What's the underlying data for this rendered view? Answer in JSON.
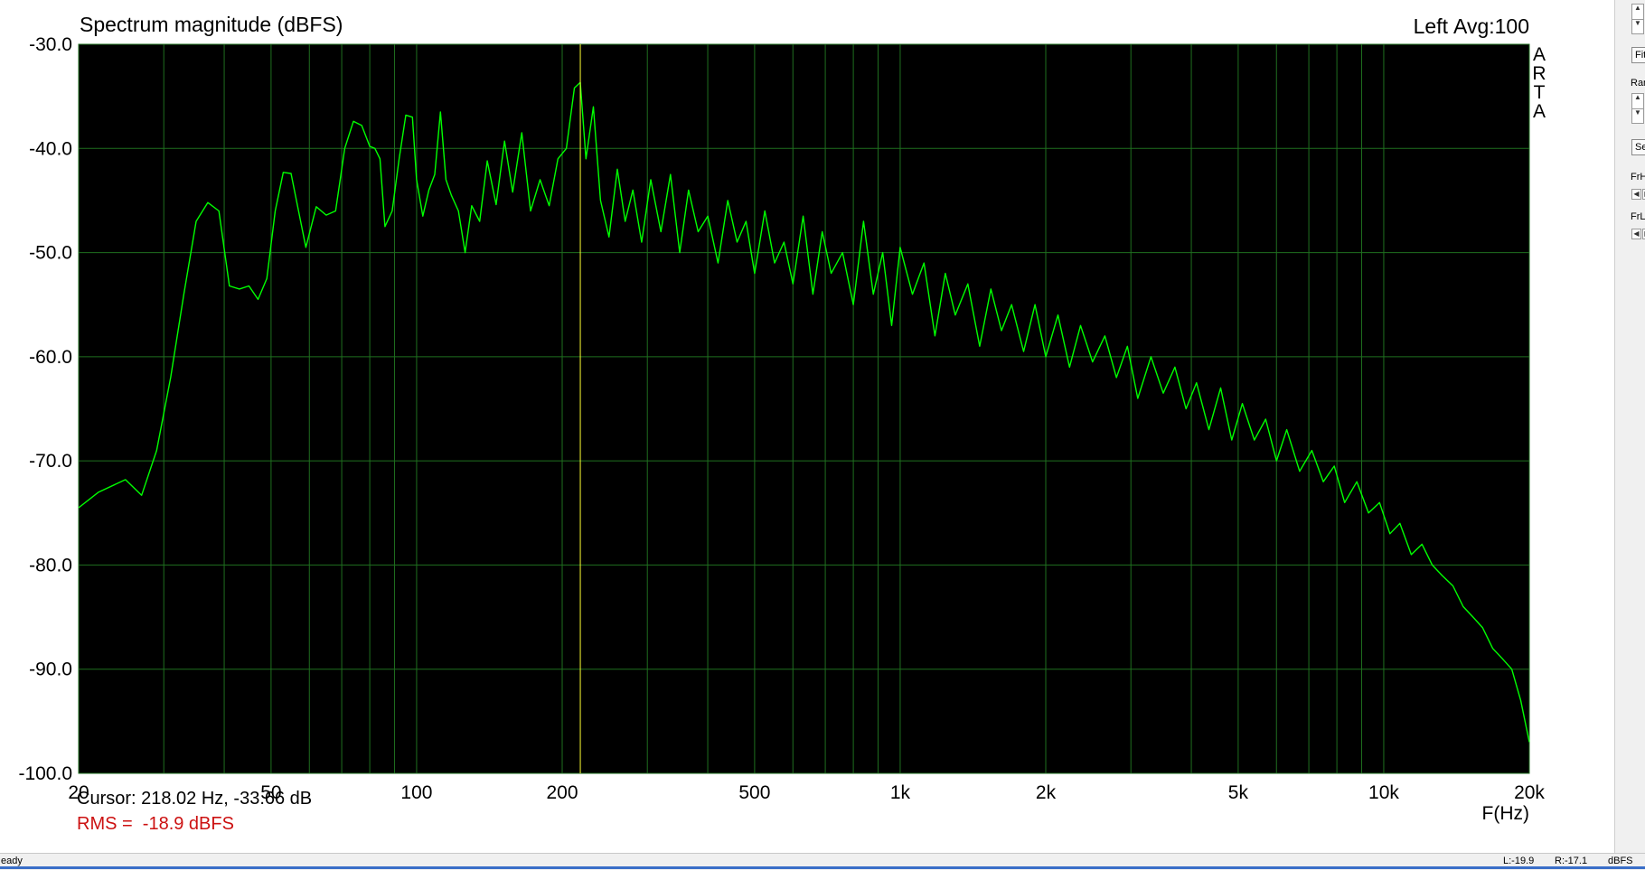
{
  "window": {
    "side_letters": [
      "A",
      "R",
      "T",
      "A"
    ]
  },
  "chart_data": {
    "type": "line",
    "title": "Spectrum magnitude (dBFS)",
    "channel_label": "Left",
    "avg_label": "Avg:100",
    "xlabel": "F(Hz)",
    "ylabel": "",
    "x_scale": "log",
    "xlim": [
      20,
      20000
    ],
    "ylim": [
      -100,
      -30
    ],
    "grid": true,
    "colors": {
      "background": "#000000",
      "grid": "#1f6f1f",
      "series": "#00ff00",
      "cursor": "#ffff33"
    },
    "x_ticks": [
      {
        "value": 20,
        "label": "20"
      },
      {
        "value": 50,
        "label": "50"
      },
      {
        "value": 100,
        "label": "100"
      },
      {
        "value": 200,
        "label": "200"
      },
      {
        "value": 500,
        "label": "500"
      },
      {
        "value": 1000,
        "label": "1k"
      },
      {
        "value": 2000,
        "label": "2k"
      },
      {
        "value": 5000,
        "label": "5k"
      },
      {
        "value": 10000,
        "label": "10k"
      },
      {
        "value": 20000,
        "label": "20k"
      }
    ],
    "y_ticks": [
      {
        "value": -30,
        "label": "-30.0"
      },
      {
        "value": -40,
        "label": "-40.0"
      },
      {
        "value": -50,
        "label": "-50.0"
      },
      {
        "value": -60,
        "label": "-60.0"
      },
      {
        "value": -70,
        "label": "-70.0"
      },
      {
        "value": -80,
        "label": "-80.0"
      },
      {
        "value": -90,
        "label": "-90.0"
      },
      {
        "value": -100,
        "label": "-100.0"
      }
    ],
    "cursor": {
      "x": 218.02,
      "y": -33.66
    },
    "series": [
      {
        "x": [
          20,
          22,
          25,
          27,
          29,
          31,
          33,
          35,
          37,
          39,
          41,
          43,
          45,
          47,
          49,
          51,
          53,
          55,
          57,
          59,
          62,
          65,
          68,
          71,
          74,
          77,
          80,
          82,
          84,
          86,
          89,
          92,
          95,
          98,
          100,
          103,
          106,
          109,
          112,
          115,
          118,
          122,
          126,
          130,
          135,
          140,
          146,
          152,
          158,
          165,
          172,
          180,
          188,
          196,
          204,
          212,
          218,
          224,
          232,
          240,
          250,
          260,
          270,
          280,
          292,
          305,
          320,
          335,
          350,
          365,
          382,
          400,
          420,
          440,
          460,
          480,
          500,
          525,
          550,
          575,
          600,
          630,
          660,
          690,
          720,
          760,
          800,
          840,
          880,
          920,
          960,
          1000,
          1060,
          1120,
          1180,
          1240,
          1300,
          1380,
          1460,
          1540,
          1620,
          1700,
          1800,
          1900,
          2000,
          2120,
          2240,
          2360,
          2500,
          2650,
          2800,
          2950,
          3100,
          3300,
          3500,
          3700,
          3900,
          4100,
          4350,
          4600,
          4850,
          5100,
          5400,
          5700,
          6000,
          6300,
          6700,
          7100,
          7500,
          7900,
          8300,
          8800,
          9300,
          9800,
          10300,
          10800,
          11400,
          12000,
          12600,
          13200,
          13900,
          14600,
          15300,
          16000,
          16800,
          17600,
          18400,
          19200,
          20000
        ],
        "values": [
          -74.5,
          -73,
          -71.8,
          -73.3,
          -69,
          -62,
          -54,
          -47,
          -45.2,
          -46,
          -53.2,
          -53.5,
          -53.2,
          -54.5,
          -52.5,
          -46,
          -42.3,
          -42.4,
          -46,
          -49.5,
          -45.6,
          -46.4,
          -46,
          -40,
          -37.4,
          -37.8,
          -39.8,
          -40,
          -41,
          -47.5,
          -46,
          -41,
          -36.8,
          -37,
          -43,
          -46.5,
          -44,
          -42.5,
          -36.5,
          -43,
          -44.5,
          -46,
          -50,
          -45.5,
          -47,
          -41.2,
          -45.4,
          -39.3,
          -44.2,
          -38.5,
          -46,
          -43,
          -45.5,
          -41,
          -40,
          -34.2,
          -33.66,
          -41,
          -36,
          -45,
          -48.5,
          -42,
          -47,
          -44,
          -49,
          -43,
          -48,
          -42.5,
          -50,
          -44,
          -48,
          -46.5,
          -51,
          -45,
          -49,
          -47,
          -52,
          -46,
          -51,
          -49,
          -53,
          -46.5,
          -54,
          -48,
          -52,
          -50,
          -55,
          -47,
          -54,
          -50,
          -57,
          -49.5,
          -54,
          -51,
          -58,
          -52,
          -56,
          -53,
          -59,
          -53.5,
          -57.5,
          -55,
          -59.5,
          -55,
          -60,
          -56,
          -61,
          -57,
          -60.5,
          -58,
          -62,
          -59,
          -64,
          -60,
          -63.5,
          -61,
          -65,
          -62.5,
          -67,
          -63,
          -68,
          -64.5,
          -68,
          -66,
          -70,
          -67,
          -71,
          -69,
          -72,
          -70.5,
          -74,
          -72,
          -75,
          -74,
          -77,
          -76,
          -79,
          -78,
          -80,
          -81,
          -82,
          -84,
          -85,
          -86,
          -88,
          -89,
          -90,
          -93,
          -97
        ]
      }
    ]
  },
  "readouts": {
    "cursor_text": "Cursor: 218.02 Hz, -33.66 dB",
    "rms_text": "RMS =  -18.9 dBFS"
  },
  "control_panel": {
    "fit_label": "Fit",
    "range_label": "Rang",
    "set_label": "Set",
    "frhigh_label": "FrHig",
    "frlow_label": "FrLo"
  },
  "status_bar": {
    "ready_text": "eady",
    "left_level": "L:-19.9",
    "right_level": "R:-17.1",
    "unit": "dBFS"
  }
}
